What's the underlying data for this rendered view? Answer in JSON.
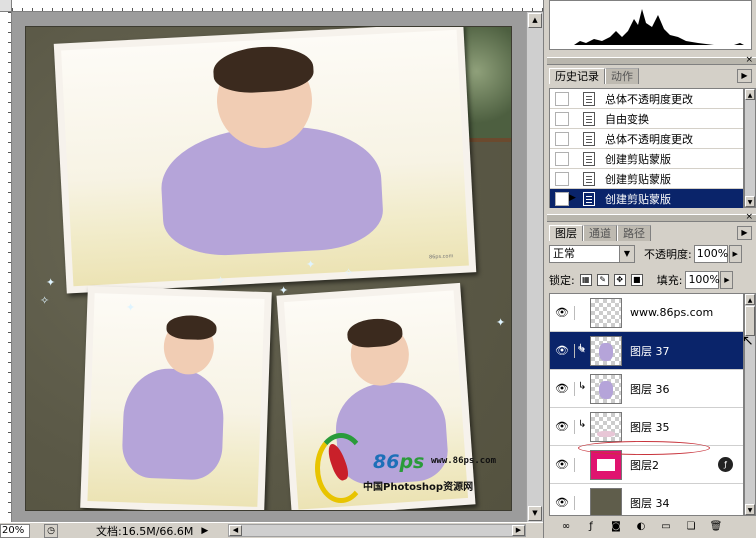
{
  "document": {
    "zoom": "20%",
    "doc_size": "文档:16.5M/66.6M",
    "status_arrow": "▶",
    "watermark": {
      "brand_number": "86",
      "brand_letters": "ps",
      "url": "www.86ps.com",
      "tagline": "中国Photoshop资源网"
    },
    "photo_caption_small": "86ps.com"
  },
  "history_panel": {
    "tabs": [
      {
        "label": "历史记录",
        "active": true
      },
      {
        "label": "动作",
        "active": false
      }
    ],
    "items": [
      {
        "label": "总体不透明度更改",
        "selected": false
      },
      {
        "label": "自由变换",
        "selected": false
      },
      {
        "label": "总体不透明度更改",
        "selected": false
      },
      {
        "label": "创建剪贴蒙版",
        "selected": false
      },
      {
        "label": "创建剪贴蒙版",
        "selected": false
      },
      {
        "label": "创建剪贴蒙版",
        "selected": true
      }
    ]
  },
  "layers_panel": {
    "tabs": [
      {
        "label": "图层",
        "active": true
      },
      {
        "label": "通道",
        "active": false
      },
      {
        "label": "路径",
        "active": false
      }
    ],
    "blend_mode": "正常",
    "opacity_label": "不透明度:",
    "opacity_value": "100%",
    "lock_label": "锁定:",
    "fill_label": "填充:",
    "fill_value": "100%",
    "layers": [
      {
        "name": "www.86ps.com",
        "selected": false,
        "clipped": false,
        "thumb": "transparent"
      },
      {
        "name": "图层 37",
        "selected": true,
        "clipped": true,
        "thumb": "baby"
      },
      {
        "name": "图层 36",
        "selected": false,
        "clipped": true,
        "thumb": "baby"
      },
      {
        "name": "图层 35",
        "selected": false,
        "clipped": true,
        "thumb": "baby"
      },
      {
        "name": "图层2",
        "selected": false,
        "clipped": false,
        "thumb": "magenta",
        "has_fx": true
      },
      {
        "name": "图层 34",
        "selected": false,
        "clipped": false,
        "thumb": "olive"
      }
    ]
  },
  "colors": {
    "selection": "#0a246a",
    "panel_bg": "#d4d0c8",
    "canvas_bg": "#5f5d4b",
    "annotation_red": "#c8343c"
  }
}
